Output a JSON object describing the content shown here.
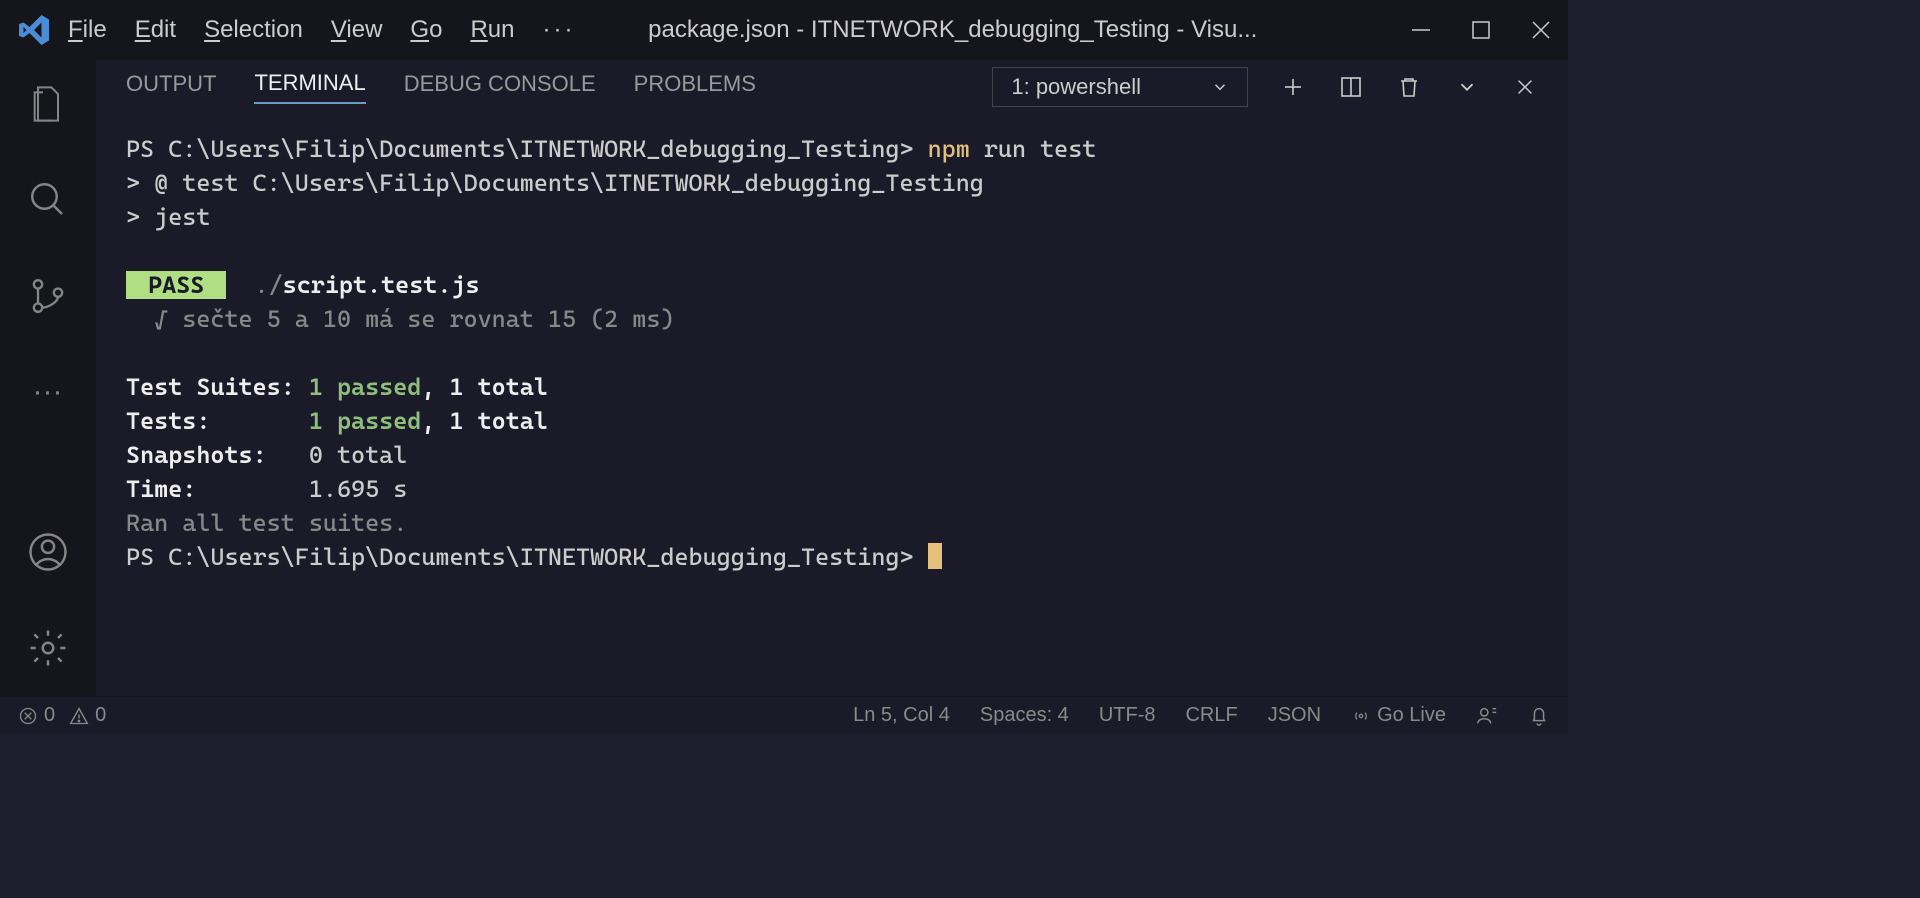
{
  "titlebar": {
    "menus": [
      "File",
      "Edit",
      "Selection",
      "View",
      "Go",
      "Run"
    ],
    "title": "package.json - ITNETWORK_debugging_Testing - Visu..."
  },
  "panel": {
    "tabs": [
      "OUTPUT",
      "TERMINAL",
      "DEBUG CONSOLE",
      "PROBLEMS"
    ],
    "activeTab": "TERMINAL",
    "terminalName": "1: powershell"
  },
  "terminal": {
    "prompt1_prefix": "PS C:\\Users\\Filip\\Documents\\ITNETWORK_debugging_Testing> ",
    "cmd1": "npm",
    "cmd1_args": " run test",
    "line2": "> @ test C:\\Users\\Filip\\Documents\\ITNETWORK_debugging_Testing",
    "line3": "> jest",
    "pass": " PASS ",
    "pass_file_pre": "  ./",
    "pass_file": "script.test.js",
    "test_line": "  √ sečte 5 a 10 má se rovnat 15 (2 ms)",
    "ts_label": "Test Suites: ",
    "ts_pass": "1 passed",
    "ts_rest": ", 1 total",
    "t_label": "Tests:       ",
    "t_pass": "1 passed",
    "t_rest": ", 1 total",
    "snap": "Snapshots:   ",
    "snap_val": "0 total",
    "time_label": "Time:        ",
    "time_val": "1.695 s",
    "ran": "Ran all test suites.",
    "prompt2": "PS C:\\Users\\Filip\\Documents\\ITNETWORK_debugging_Testing> "
  },
  "statusbar": {
    "errors": "0",
    "warnings": "0",
    "lncol": "Ln 5, Col 4",
    "spaces": "Spaces: 4",
    "encoding": "UTF-8",
    "eol": "CRLF",
    "lang": "JSON",
    "golive": "Go Live"
  }
}
